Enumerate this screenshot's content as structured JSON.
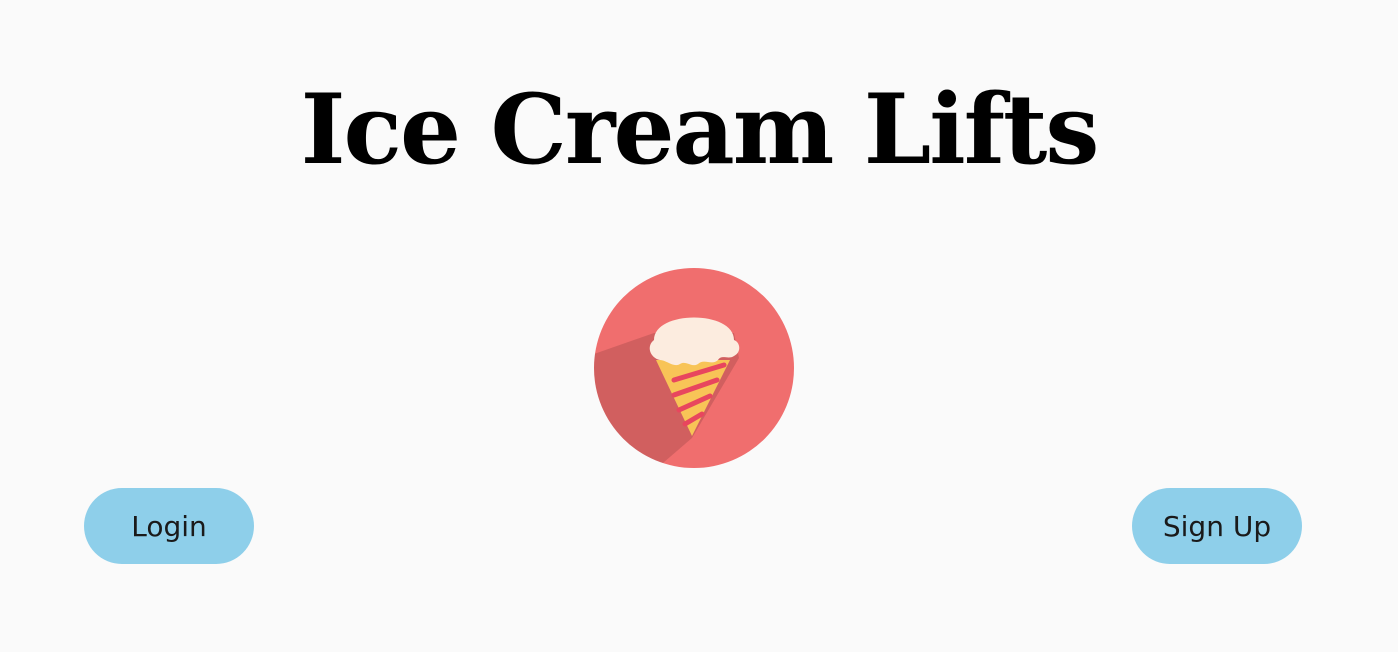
{
  "app": {
    "title": "Ice Cream Lifts"
  },
  "logo": {
    "icon": "ice-cream-cone-icon",
    "background_color": "#f06e6e"
  },
  "actions": {
    "login_label": "Login",
    "signup_label": "Sign Up",
    "button_color": "#8ecfea"
  }
}
